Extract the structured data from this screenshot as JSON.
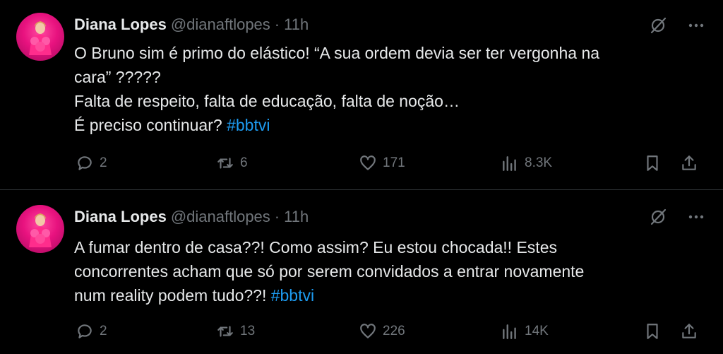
{
  "tweets": [
    {
      "author": {
        "name": "Diana Lopes",
        "handle": "@dianaftlopes",
        "time": "11h"
      },
      "text_lines": [
        "O Bruno sim é primo do elástico! “A sua ordem devia ser ter vergonha na",
        "cara” ?????",
        "Falta de respeito, falta de educação, falta de noção…",
        "É preciso continuar?"
      ],
      "hashtag": "#bbtvi",
      "stats": {
        "replies": "2",
        "reposts": "6",
        "likes": "171",
        "views": "8.3K"
      }
    },
    {
      "author": {
        "name": "Diana Lopes",
        "handle": "@dianaftlopes",
        "time": "11h"
      },
      "text_lines": [
        "A fumar dentro de casa??! Como assim? Eu estou chocada!! Estes",
        "concorrentes acham que só por serem convidados a entrar novamente",
        "num reality podem tudo??!"
      ],
      "hashtag": "#bbtvi",
      "stats": {
        "replies": "2",
        "reposts": "13",
        "likes": "226",
        "views": "14K"
      }
    }
  ],
  "icons": {
    "avatar": "avatar-image",
    "grok": "grok-icon",
    "more": "more-icon",
    "reply": "reply-icon",
    "repost": "repost-icon",
    "like": "like-icon",
    "views": "views-icon",
    "bookmark": "bookmark-icon",
    "share": "share-icon"
  },
  "colors": {
    "background": "#000000",
    "text": "#e7e9ea",
    "muted": "#71767b",
    "link": "#1d9bf0",
    "divider": "#2f3336"
  }
}
